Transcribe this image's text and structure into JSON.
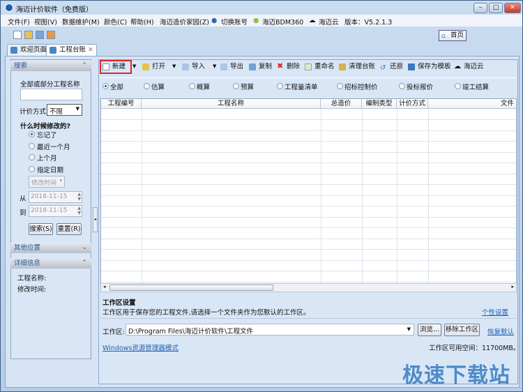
{
  "window": {
    "title": "海迈计价软件（免费版）",
    "controls": [
      "–",
      "□",
      "✕"
    ]
  },
  "menu": [
    "文件(F)",
    "视图(V)",
    "数据维护(M)",
    "颜色(C)",
    "帮助(H)",
    "海迈造价家园(Z)",
    "切换账号",
    "海迈BDM360",
    "海迈云",
    "版本：V5.2.1.3"
  ],
  "home_button": "首页",
  "tabs": [
    {
      "label": "欢迎页面"
    },
    {
      "label": "工程台账",
      "close": "✕"
    }
  ],
  "search_panel": {
    "header": "搜索",
    "name_label": "全部或部分工程名称",
    "name_value": "",
    "pricing_label": "计价方式",
    "pricing_value": "不限",
    "when_label": "什么时候修改的?",
    "options": [
      "忘记了",
      "最近一个月",
      "上个月",
      "指定日期"
    ],
    "selected": 0,
    "time_field": "修改时间",
    "from_label": "从",
    "from_date": "2018-11-15",
    "to_label": "到",
    "to_date": "2018-11-15",
    "search_button": "搜索(S)",
    "reset_button": "重置(R)"
  },
  "other_panel": {
    "header": "其他位置"
  },
  "detail_panel": {
    "header": "详细信息",
    "name_label": "工程名称:",
    "time_label": "修改时间:"
  },
  "toolbar": [
    "新建",
    "打开",
    "导入",
    "导出",
    "复制",
    "删除",
    "重命名",
    "清理台账",
    "还原",
    "保存为模板",
    "海迈云"
  ],
  "filters": {
    "options": [
      "全部",
      "估算",
      "概算",
      "预算",
      "工程量清单",
      "招标控制价",
      "投标报价",
      "竣工结算"
    ],
    "selected": 0
  },
  "table": {
    "columns": [
      "工程编号",
      "工程名称",
      "总造价",
      "编制类型",
      "计价方式",
      "文件"
    ],
    "rows": []
  },
  "workspace": {
    "title": "工作区设置",
    "desc": "工作区用于保存您的工程文件,请选择一个文件夹作为您默认的工作区。",
    "personal_link": "个性设置",
    "label": "工作区:",
    "path": "D:\\Program Files\\海迈计价软件\\工程文件",
    "browse": "浏览...",
    "move": "移除工作区",
    "restore_link": "恢复默认",
    "explorer_link": "Windows资源管理器模式",
    "free_space": "工作区可用空间：11700MB。"
  },
  "watermark": "极速下载站",
  "colors": {
    "accent": "#1f5fb0",
    "highlight": "#e0262b"
  }
}
